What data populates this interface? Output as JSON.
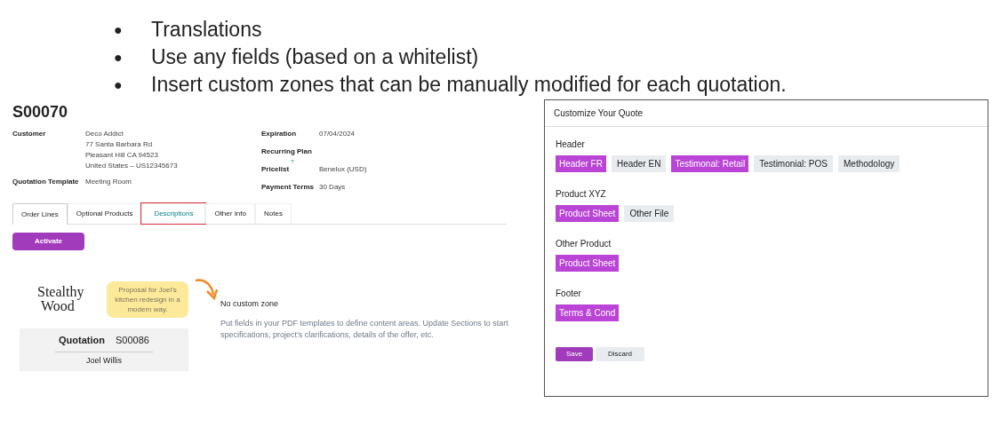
{
  "bullets": [
    {
      "marker": "●",
      "text": "Translations"
    },
    {
      "marker": "●",
      "text": "Use any fields (based on a whitelist)"
    },
    {
      "marker": "●",
      "text": "Insert custom zones that can be manually modified for each quotation."
    }
  ],
  "quote": {
    "title": "S00070",
    "left_fields": [
      {
        "label": "Customer",
        "lines": [
          "Deco Addict",
          "77 Santa Barbara Rd",
          "Pleasant Hill CA 94523",
          "United States – US12345673"
        ]
      },
      {
        "label": "Quotation Template",
        "lines": [
          "Meeting Room"
        ]
      }
    ],
    "right_fields": [
      {
        "label": "Expiration",
        "value": "07/04/2024"
      },
      {
        "label": "Recurring Plan"
      },
      {
        "label": "Pricelist",
        "help": "?",
        "value": "Benelux (USD)"
      },
      {
        "label": "Payment Terms",
        "value": "30 Days"
      }
    ],
    "tabs": [
      {
        "label": "Order Lines",
        "selected": true,
        "highlighted": false
      },
      {
        "label": "Optional Products",
        "selected": false,
        "highlighted": false
      },
      {
        "label": "Descriptions",
        "selected": false,
        "highlighted": true
      },
      {
        "label": "Other Info",
        "selected": false,
        "highlighted": false
      },
      {
        "label": "Notes",
        "selected": false,
        "highlighted": false
      }
    ],
    "activate_button": "Activate",
    "preview": {
      "logo": [
        "Stealthy",
        "Wood"
      ],
      "note": "Proposal for Joel's kitchen redesign in a modern way.",
      "doc_label": "Quotation",
      "doc_number": "S00086",
      "customer": "Joel Willis"
    },
    "empty_state": {
      "title": "No custom zone",
      "body": "Put fields in your PDF templates to define content areas. Update Sections to start specifications, project's clarifications, details of the offer, etc."
    }
  },
  "dialog": {
    "title": "Customize Your Quote",
    "sections": [
      {
        "name": "Header",
        "options": [
          {
            "label": "Header FR",
            "selected": true
          },
          {
            "label": "Header EN",
            "selected": false
          },
          {
            "label": "Testimonal: Retail",
            "selected": true
          },
          {
            "label": "Testimonial: POS",
            "selected": false
          },
          {
            "label": "Methodology",
            "selected": false
          }
        ]
      },
      {
        "name": "Product XYZ",
        "options": [
          {
            "label": "Product Sheet",
            "selected": true
          },
          {
            "label": "Other File",
            "selected": false
          }
        ]
      },
      {
        "name": "Other Product",
        "options": [
          {
            "label": "Product Sheet",
            "selected": true
          }
        ]
      },
      {
        "name": "Footer",
        "options": [
          {
            "label": "Terms & Cond",
            "selected": true
          }
        ]
      }
    ],
    "buttons": [
      {
        "label": "Save",
        "kind": "primary"
      },
      {
        "label": "Discard",
        "kind": "secondary"
      }
    ]
  }
}
